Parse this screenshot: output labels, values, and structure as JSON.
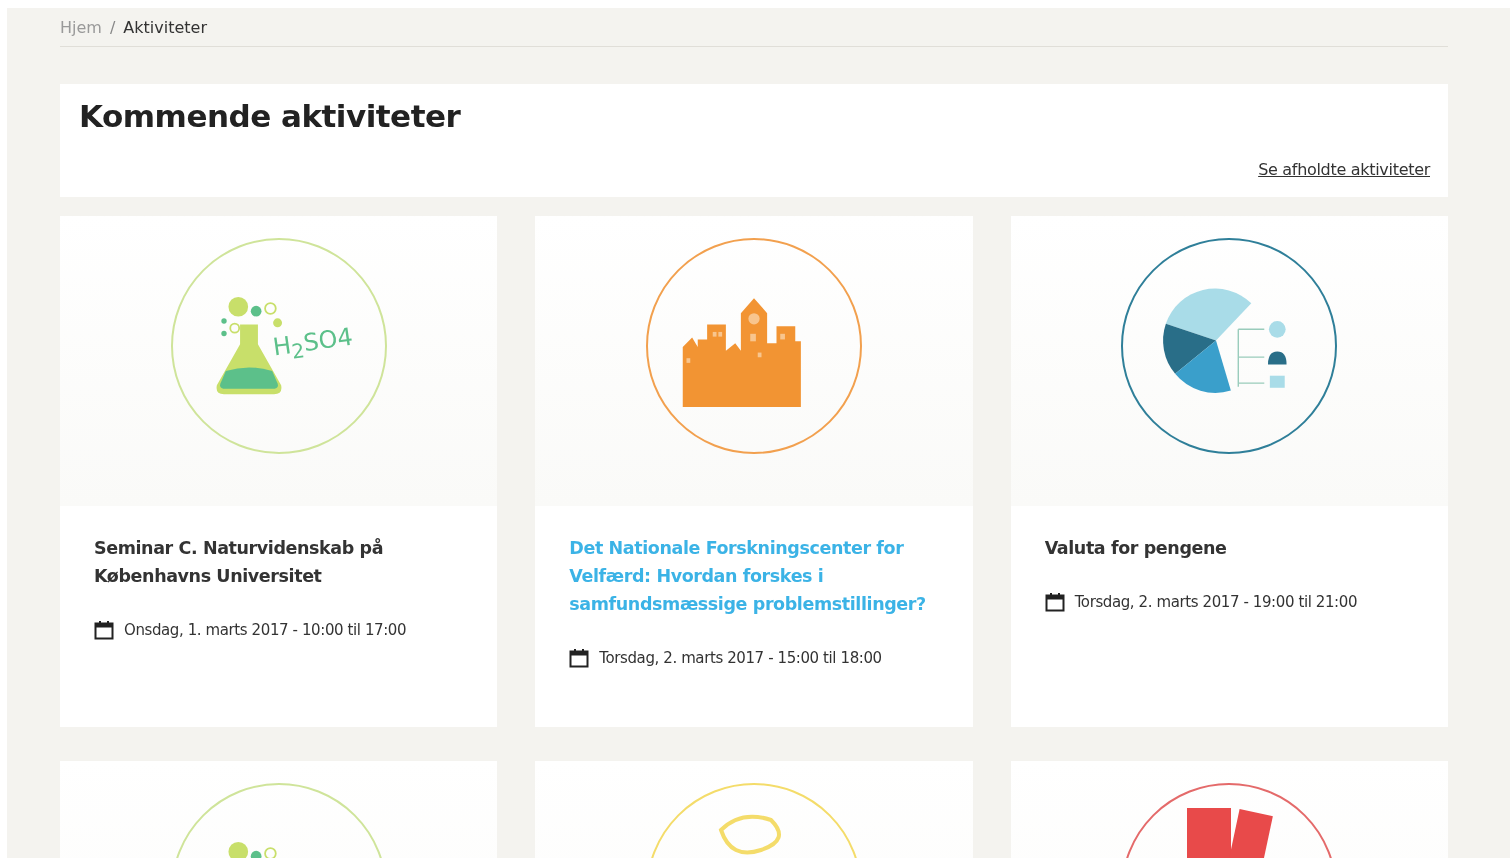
{
  "breadcrumb": {
    "separator": "/",
    "items": [
      {
        "label": "Hjem",
        "current": false
      },
      {
        "label": "Aktiviteter",
        "current": true
      }
    ]
  },
  "header": {
    "title": "Kommende aktiviteter",
    "link": "Se afholdte aktiviteter"
  },
  "activities": [
    {
      "kind": "flask",
      "color": "#cfe49a",
      "icon_text": "H$_{2}$SO4",
      "title": "Seminar C. Naturvidenskab på Københavns Universitet",
      "highlighted": false,
      "date": "Onsdag, 1. marts 2017 - 10:00 til 17:00"
    },
    {
      "kind": "city",
      "color": "#f2a04e",
      "title": "Det Nationale Forskningscenter for Velfærd: Hvordan forskes i samfundsmæssige problemstillinger?",
      "highlighted": true,
      "date": "Torsdag, 2. marts 2017 - 15:00 til 18:00"
    },
    {
      "kind": "pie",
      "color": "#2f7f99",
      "title": "Valuta for pengene",
      "highlighted": false,
      "date": "Torsdag, 2. marts 2017 - 19:00 til 21:00"
    },
    {
      "kind": "flask",
      "color": "#cfe49a"
    },
    {
      "kind": "blob",
      "color": "#f4dc6a"
    },
    {
      "kind": "books",
      "color": "#e46a6a"
    }
  ]
}
